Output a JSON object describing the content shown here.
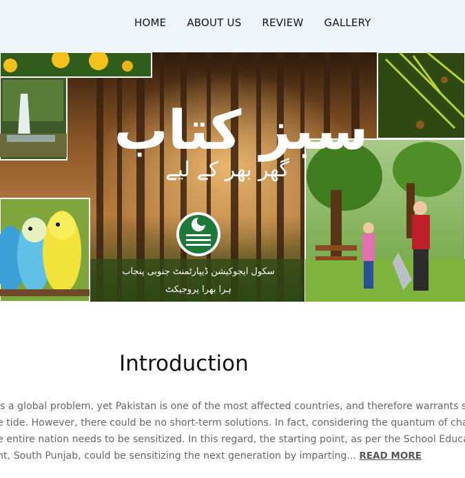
{
  "nav": {
    "items": [
      {
        "label": "HOME"
      },
      {
        "label": "ABOUT US"
      },
      {
        "label": "REVIEW"
      },
      {
        "label": "GALLERY"
      }
    ]
  },
  "hero": {
    "urdu_title": "سبز کتاب",
    "urdu_subtitle": "گھر بھر کے لیے",
    "urdu_dept_line": "سکول ایجوکیشن ڈیپارٹمنٹ جنوبی پنجاب",
    "urdu_project_line": "ہرا بھرا پروجیکٹ",
    "colors": {
      "forest_dark": "#3b2412",
      "forest_mid": "#7a4b22",
      "sunlight": "#e9a94c",
      "grass": "#4f8a2a",
      "logo_green": "#1e7a3a"
    }
  },
  "intro": {
    "title": "Introduction",
    "lines": [
      " is a global problem, yet Pakistan is one of the most affected countries, and therefore warrants s",
      "e tide. However, there could be no short-term solutions. In fact, considering the quantum of chal",
      "e entire nation needs to be sensitized. In this regard, the starting point, as per the School Educat",
      "nt, South Punjab, could be sensitizing the next generation by imparting... "
    ],
    "read_more": "READ MORE"
  }
}
